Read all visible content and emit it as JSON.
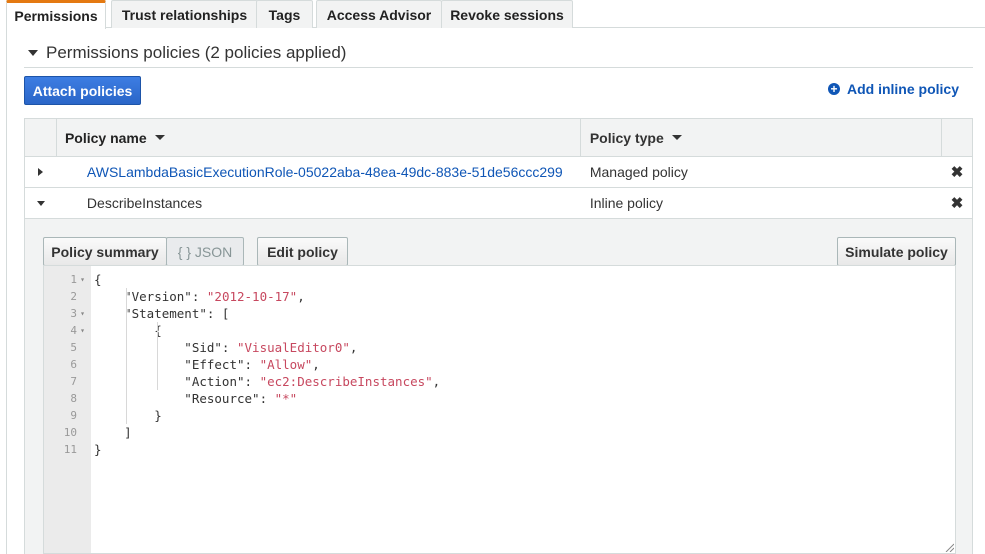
{
  "tabs": [
    "Permissions",
    "Trust relationships",
    "Tags",
    "Access Advisor",
    "Revoke sessions"
  ],
  "section_title": "Permissions policies (2 policies applied)",
  "attach_button": "Attach policies",
  "add_inline": "Add inline policy",
  "table": {
    "headers": {
      "name": "Policy name",
      "type": "Policy type"
    },
    "rows": [
      {
        "name": "AWSLambdaBasicExecutionRole-05022aba-48ea-49dc-883e-51de56ccc299",
        "type": "Managed policy"
      },
      {
        "name": "DescribeInstances",
        "type": "Inline policy"
      }
    ]
  },
  "panel": {
    "summary_button": "Policy summary",
    "json_button": "{ } JSON",
    "edit_button": "Edit policy",
    "simulate_button": "Simulate policy"
  },
  "code": {
    "line_numbers": [
      "1",
      "2",
      "3",
      "4",
      "5",
      "6",
      "7",
      "8",
      "9",
      "10",
      "11"
    ],
    "lines": [
      [
        {
          "t": "{"
        }
      ],
      [
        {
          "t": "    \"Version\": "
        },
        {
          "t": "\"2012-10-17\"",
          "s": 1
        },
        {
          "t": ","
        }
      ],
      [
        {
          "t": "    \"Statement\": ["
        }
      ],
      [
        {
          "t": "        {"
        }
      ],
      [
        {
          "t": "            \"Sid\": "
        },
        {
          "t": "\"VisualEditor0\"",
          "s": 1
        },
        {
          "t": ","
        }
      ],
      [
        {
          "t": "            \"Effect\": "
        },
        {
          "t": "\"Allow\"",
          "s": 1
        },
        {
          "t": ","
        }
      ],
      [
        {
          "t": "            \"Action\": "
        },
        {
          "t": "\"ec2:DescribeInstances\"",
          "s": 1
        },
        {
          "t": ","
        }
      ],
      [
        {
          "t": "            \"Resource\": "
        },
        {
          "t": "\"*\"",
          "s": 1
        }
      ],
      [
        {
          "t": "        }"
        }
      ],
      [
        {
          "t": "    ]"
        }
      ],
      [
        {
          "t": "}"
        }
      ]
    ]
  }
}
